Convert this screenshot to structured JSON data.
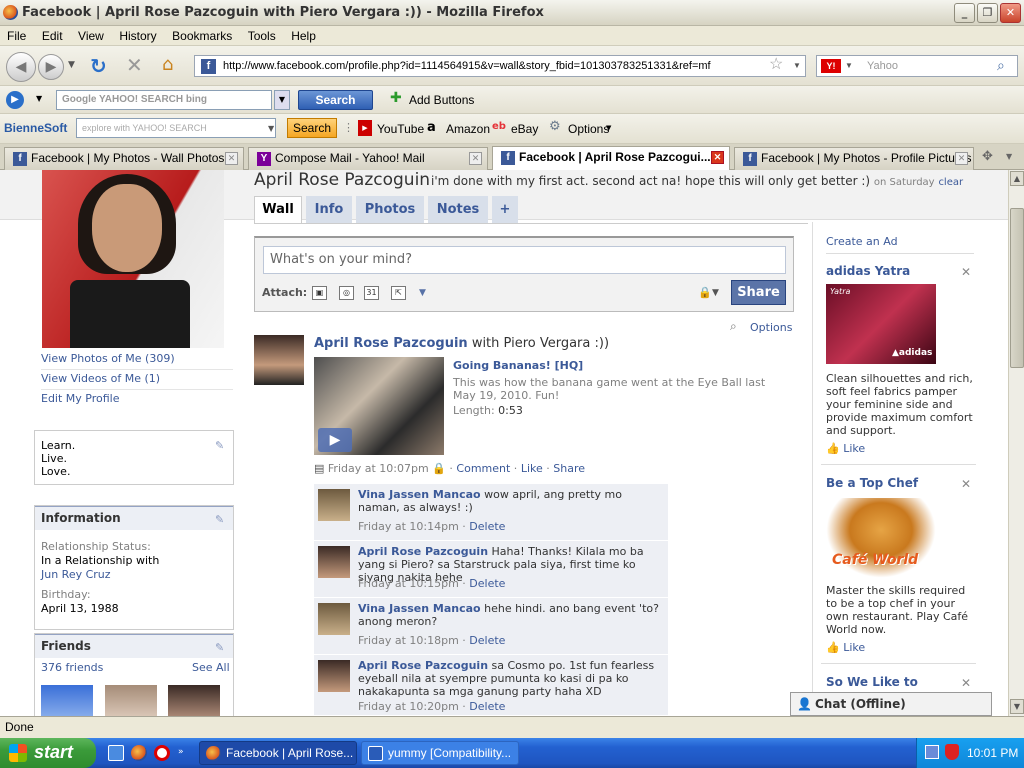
{
  "window": {
    "title": "Facebook | April Rose Pazcoguin with Piero Vergara :)) - Mozilla Firefox"
  },
  "menu": [
    "File",
    "Edit",
    "View",
    "History",
    "Bookmarks",
    "Tools",
    "Help"
  ],
  "nav": {
    "url": "http://www.facebook.com/profile.php?id=1114564915&v=wall&story_fbid=101303783251331&ref=mf",
    "search_placeholder": "Yahoo"
  },
  "toolbar1": {
    "search_logos": "Google YAHOO! SEARCH bing",
    "search_button": "Search",
    "add_buttons": "Add Buttons"
  },
  "toolbar2": {
    "brand": "BienneSoft",
    "explore_placeholder": "explore with YAHOO! SEARCH",
    "search_button": "Search",
    "youtube": "YouTube",
    "amazon": "Amazon",
    "ebay": "eBay",
    "options": "Options"
  },
  "tabs": [
    {
      "label": "Facebook | My Photos - Wall Photos",
      "active": false
    },
    {
      "label": "Compose Mail - Yahoo! Mail",
      "active": false
    },
    {
      "label": "Facebook | April Rose Pazcogui...",
      "active": true
    },
    {
      "label": "Facebook | My Photos - Profile Pictures",
      "active": false
    }
  ],
  "profile": {
    "name": "April Rose Pazcoguin",
    "status": "i'm done with my first act. second act na! hope this will only get better :)",
    "status_time": "on Saturday",
    "status_clear": "clear",
    "tabs": [
      "Wall",
      "Info",
      "Photos",
      "Notes",
      "+"
    ],
    "links": [
      "View Photos of Me (309)",
      "View Videos of Me (1)",
      "Edit My Profile"
    ],
    "bio": [
      "Learn.",
      "Live.",
      "Love."
    ],
    "information": {
      "heading": "Information",
      "relationship_label": "Relationship Status:",
      "relationship_value": "In a Relationship with",
      "partner": "Jun Rey Cruz",
      "birthday_label": "Birthday:",
      "birthday_value": "April 13, 1988"
    },
    "friends": {
      "heading": "Friends",
      "count": "376 friends",
      "see_all": "See All"
    }
  },
  "publisher": {
    "placeholder": "What's on your mind?",
    "attach_label": "Attach:",
    "share_button": "Share",
    "options": "Options"
  },
  "post": {
    "author": "April Rose Pazcoguin",
    "with": "with Piero Vergara :))",
    "video_title": "Going Bananas! [HQ]",
    "video_desc": "This was how the banana game went at the Eye Ball last May 19, 2010. Fun!",
    "length_label": "Length:",
    "length_value": "0:53",
    "time": "Friday at 10:07pm",
    "actions": [
      "Comment",
      "Like",
      "Share"
    ]
  },
  "comments": [
    {
      "author": "Vina Jassen Mancao",
      "text": "wow april, ang pretty mo naman, as always! :)",
      "time": "Friday at 10:14pm",
      "delete": "Delete"
    },
    {
      "author": "April Rose Pazcoguin",
      "text": "Haha! Thanks! Kilala mo ba yang si Piero? sa Starstruck pala siya, first time ko siyang nakita hehe",
      "time": "Friday at 10:15pm",
      "delete": "Delete"
    },
    {
      "author": "Vina Jassen Mancao",
      "text": "hehe hindi. ano bang event 'to? anong meron?",
      "time": "Friday at 10:18pm",
      "delete": "Delete"
    },
    {
      "author": "April Rose Pazcoguin",
      "text": "sa Cosmo po. 1st fun fearless eyeball nila at syempre pumunta ko kasi di pa ko nakakapunta sa mga ganung party haha XD",
      "time": "Friday at 10:20pm",
      "delete": "Delete"
    }
  ],
  "ads": {
    "create": "Create an Ad",
    "items": [
      {
        "title": "adidas Yatra",
        "image_text": "Yatra",
        "body": "Clean silhouettes and rich, soft feel fabrics pamper your feminine side and provide maximum comfort and support.",
        "like": "Like"
      },
      {
        "title": "Be a Top Chef",
        "image_text": "Café World",
        "body": "Master the skills required to be a top chef in your own restaurant. Play Café World now.",
        "like": "Like"
      },
      {
        "title": "So We Like to"
      }
    ]
  },
  "chat": {
    "label": "Chat (Offline)"
  },
  "statusbar": {
    "text": "Done"
  },
  "taskbar": {
    "start": "start",
    "tasks": [
      "Facebook | April Rose...",
      "yummy [Compatibility..."
    ],
    "clock": "10:01 PM"
  },
  "colors": {
    "facebook_blue": "#3b5998",
    "taskbar_blue": "#2361d1",
    "start_green": "#3b9b3a"
  }
}
